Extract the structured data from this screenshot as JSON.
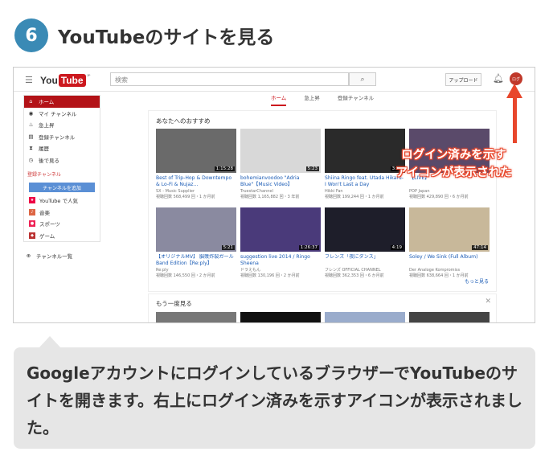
{
  "step": {
    "number": "6",
    "title": "YouTubeのサイトを見る"
  },
  "topbar": {
    "logo_you": "You",
    "logo_tube": "Tube",
    "logo_sup": "JP",
    "search_placeholder": "検索",
    "upload_label": "アップロード",
    "avatar_label": "ログ"
  },
  "sidebar": {
    "items": [
      {
        "label": "ホーム",
        "icon": "home-icon",
        "glyph": "⌂"
      },
      {
        "label": "マイ チャンネル",
        "icon": "person-icon",
        "glyph": "◉"
      },
      {
        "label": "急上昇",
        "icon": "flame-icon",
        "glyph": "♨"
      },
      {
        "label": "登録チャンネル",
        "icon": "subscriptions-icon",
        "glyph": "▤"
      },
      {
        "label": "履歴",
        "icon": "history-icon",
        "glyph": "⧗"
      },
      {
        "label": "後で見る",
        "icon": "clock-icon",
        "glyph": "◷"
      }
    ],
    "section_label": "登録チャンネル",
    "add_channel_label": "チャンネルを追加",
    "sub_items": [
      {
        "label": "YouTube で人気",
        "icon": "popular-icon",
        "glyph": "★"
      },
      {
        "label": "音楽",
        "icon": "music-icon",
        "glyph": "♪"
      },
      {
        "label": "スポーツ",
        "icon": "sports-icon",
        "glyph": "●"
      },
      {
        "label": "ゲーム",
        "icon": "gaming-icon",
        "glyph": "◆"
      }
    ],
    "channel_list_label": "チャンネル一覧"
  },
  "tabs": [
    {
      "label": "ホーム"
    },
    {
      "label": "急上昇"
    },
    {
      "label": "登録チャンネル"
    }
  ],
  "recommended": {
    "title": "あなたへのおすすめ",
    "more_label": "もっと見る",
    "videos": [
      {
        "title": "Best of Trip-Hop & Downtempo & Lo-Fi & Nujaz...",
        "channel": "SX - Music Supplier",
        "views": "視聴回数 568,499 回・1 か月前",
        "duration": "1:15:28",
        "bg": "#6a6a6a"
      },
      {
        "title": "bohemianvoodoo \"Adria Blue\"【Music Video】",
        "channel": "TruestarChannel",
        "views": "視聴回数 1,165,882 回・3 年前",
        "duration": "5:23",
        "bg": "#d8d8d8"
      },
      {
        "title": "Shiina Ringo feat. Utada Hikaru- I Won't Last a Day",
        "channel": "Hikki Fan",
        "views": "視聴回数 199,244 回・1 か月前",
        "duration": "3:52",
        "bg": "#2a2a2a"
      },
      {
        "title": "【LIVE】",
        "channel": "POP Japan",
        "views": "視聴回数 429,890 回・6 か月前",
        "duration": "",
        "bg": "#5a4a6a"
      },
      {
        "title": "【オリジナルMV】 脳漿炸裂ガール Band Edition【Re:ply】",
        "channel": "Re:ply",
        "views": "視聴回数 146,550 回・2 か月前",
        "duration": "5:21",
        "bg": "#8a8aa0"
      },
      {
        "title": "suggestion live 2014 / Ringo Sheena",
        "channel": "ドラえもん",
        "views": "視聴回数 130,196 回・2 か月前",
        "duration": "1:26:37",
        "bg": "#4a3a7a"
      },
      {
        "title": "フレンズ「夜にダンス」",
        "channel": "フレンズ OFFICIAL CHANNEL",
        "views": "視聴回数 362,353 回・6 か月前",
        "duration": "4:19",
        "bg": "#1e1e2a"
      },
      {
        "title": "Soley / We Sink (Full Album)",
        "channel": "Der Analoge Kompromiss",
        "views": "視聴回数 638,664 回・1 か月前",
        "duration": "47:14",
        "bg": "#c8b89a"
      }
    ]
  },
  "watch_again": {
    "title": "もう一度見る"
  },
  "annotation": {
    "line1": "ログイン済みを示す",
    "line2": "アイコンが表示された"
  },
  "caption": "GoogleアカウントにログインしているブラウザーでYouTubeのサイトを開きます。右上にログイン済みを示すアイコンが表示されました。",
  "colors": {
    "accent": "#cc181e",
    "badge": "#3a8ab5",
    "annotation": "#e8472c"
  }
}
